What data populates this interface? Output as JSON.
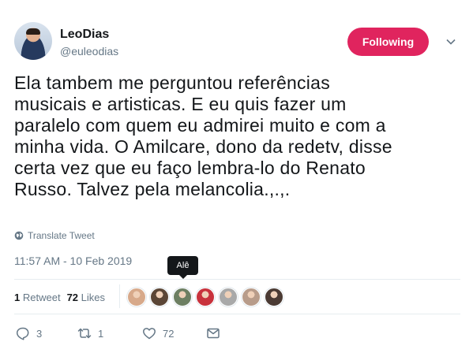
{
  "author": {
    "display_name": "LeoDias",
    "handle": "@euleodias",
    "avatar_icon": "avatar"
  },
  "follow_button_label": "Following",
  "follow_button_color": "#e0245e",
  "tweet_lines": [
    "Ela tambem me perguntou referências",
    "musicais e artisticas. E eu quis fazer um",
    "paralelo com quem eu admirei muito e com a",
    "minha vida. O Amilcare, dono da redetv, disse",
    "certa vez que eu faço lembra-lo do Renato",
    "Russo. Talvez pela melancolia.,.,."
  ],
  "translate_label": "Translate Tweet",
  "timestamp": "11:57 AM - 10 Feb 2019",
  "tooltip_text": "Alê",
  "stats": {
    "retweets_count": "1",
    "retweets_label": "Retweet",
    "likes_count": "72",
    "likes_label": "Likes"
  },
  "likers": [
    {
      "icon": "liker-avatar",
      "color": "#d7a98a"
    },
    {
      "icon": "liker-avatar",
      "color": "#5b4636"
    },
    {
      "icon": "liker-avatar",
      "color": "#6d7f62"
    },
    {
      "icon": "liker-avatar",
      "color": "#c8323c"
    },
    {
      "icon": "liker-avatar",
      "color": "#a9a9a9"
    },
    {
      "icon": "liker-avatar",
      "color": "#b89c8a"
    },
    {
      "icon": "liker-avatar",
      "color": "#4a3a33"
    }
  ],
  "actions": {
    "reply_count": "3",
    "retweet_count": "1",
    "like_count": "72"
  }
}
